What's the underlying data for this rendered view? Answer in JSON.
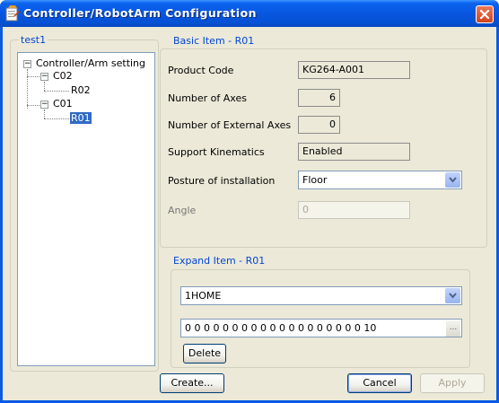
{
  "window": {
    "title": "Controller/RobotArm Configuration"
  },
  "tree_group": {
    "label": "test1"
  },
  "tree": {
    "root": "Controller/Arm setting",
    "nodes": [
      {
        "label": "C02",
        "children": [
          "R02"
        ]
      },
      {
        "label": "C01",
        "children": [
          "R01"
        ]
      }
    ],
    "selected": "R01"
  },
  "basic": {
    "group_label": "Basic Item - R01",
    "product_code_label": "Product Code",
    "product_code": "KG264-A001",
    "axes_label": "Number of Axes",
    "axes": "6",
    "ext_axes_label": "Number of External Axes",
    "ext_axes": "0",
    "kinematics_label": "Support Kinematics",
    "kinematics": "Enabled",
    "posture_label": "Posture of installation",
    "posture": "Floor",
    "angle_label": "Angle",
    "angle": "0"
  },
  "expand": {
    "group_label": "Expand Item - R01",
    "selection": "1HOME",
    "value": "0 0 0 0 0 0 0 0 0 0 0 0 0 0 0 0 0 0 0 10",
    "ellipsis": "...",
    "delete_label": "Delete"
  },
  "footer": {
    "create_label": "Create...",
    "cancel_label": "Cancel",
    "apply_label": "Apply"
  }
}
